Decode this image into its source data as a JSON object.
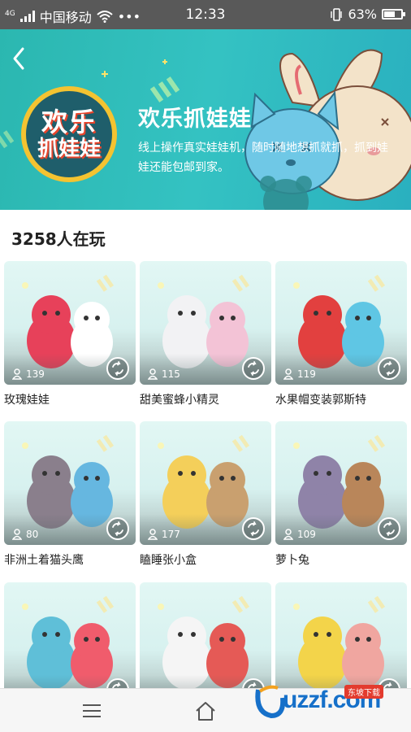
{
  "status_bar": {
    "network": "4G",
    "carrier": "中国移动",
    "dots": "•••",
    "time": "12:33",
    "battery": "63%",
    "battery_level": 0.63
  },
  "banner": {
    "logo_line1": "欢乐",
    "logo_line2": "抓娃娃",
    "title": "欢乐抓娃娃",
    "description": "线上操作真实娃娃机，随时随地想抓就抓，抓到娃娃还能包邮到家。"
  },
  "players_text": "3258人在玩",
  "items": [
    {
      "name": "玫瑰娃娃",
      "count": "139"
    },
    {
      "name": "甜美蜜蜂小精灵",
      "count": "115"
    },
    {
      "name": "水果帽变装郭斯特",
      "count": "119"
    },
    {
      "name": "非洲土着猫头鹰",
      "count": "80"
    },
    {
      "name": "瞌睡张小盒",
      "count": "177"
    },
    {
      "name": "萝卜兔",
      "count": "109"
    },
    {
      "name": "",
      "count": ""
    },
    {
      "name": "",
      "count": ""
    },
    {
      "name": "",
      "count": ""
    }
  ],
  "watermark": {
    "text": "uzzf.com",
    "tag": "东坡下载"
  },
  "colors": {
    "banner": "#2bb7b0",
    "logo_ring": "#f4c331",
    "watermark": "#1670c9"
  },
  "icons": [
    "back-arrow-icon",
    "person-icon",
    "swap-icon",
    "menu-icon",
    "home-icon",
    "wifi-icon",
    "signal-icon"
  ]
}
